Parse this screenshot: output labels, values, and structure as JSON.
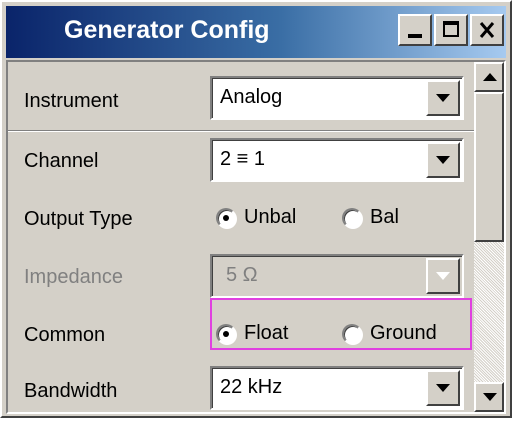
{
  "window": {
    "title": "Generator Config",
    "buttons": {
      "minimize": "minimize-icon",
      "maximize": "maximize-icon",
      "close": "close-icon"
    }
  },
  "form": {
    "instrument": {
      "label": "Instrument",
      "value": "Analog"
    },
    "channel": {
      "label": "Channel",
      "value": "2 ≡ 1"
    },
    "output_type": {
      "label": "Output Type",
      "options": [
        "Unbal",
        "Bal"
      ],
      "selected": "Unbal"
    },
    "impedance": {
      "label": "Impedance",
      "value": "5 Ω",
      "disabled": true
    },
    "common": {
      "label": "Common",
      "options": [
        "Float",
        "Ground"
      ],
      "selected": "Float"
    },
    "bandwidth": {
      "label": "Bandwidth",
      "value": "22 kHz"
    }
  },
  "colors": {
    "title_start": "#0a246a",
    "title_end": "#a6caf0",
    "highlight": "#e040e0",
    "face": "#d4d0c8"
  }
}
